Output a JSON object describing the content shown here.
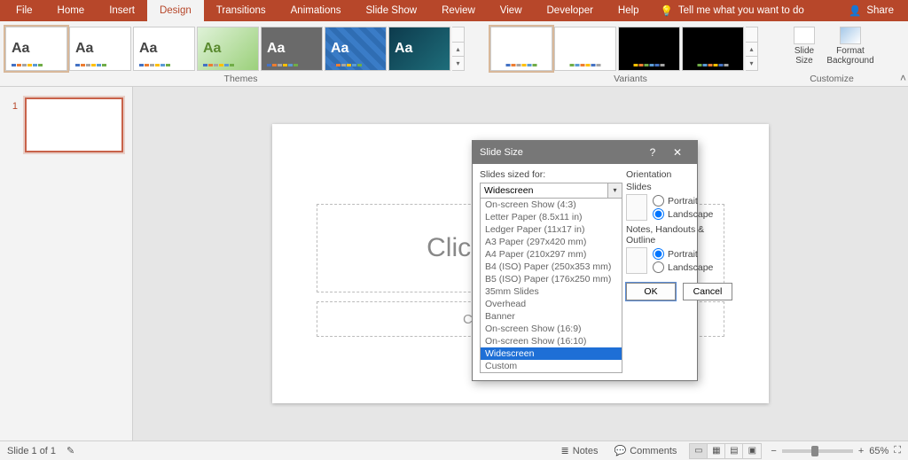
{
  "app": "PowerPoint",
  "accent": "#b7472a",
  "ribbon": {
    "tabs": [
      "File",
      "Home",
      "Insert",
      "Design",
      "Transitions",
      "Animations",
      "Slide Show",
      "Review",
      "View",
      "Developer",
      "Help"
    ],
    "active_tab_index": 3,
    "tell_me": "Tell me what you want to do",
    "share": "Share"
  },
  "groups": {
    "themes_label": "Themes",
    "variants_label": "Variants",
    "customize_label": "Customize",
    "slide_size_label": "Slide\nSize",
    "format_bg_label": "Format\nBackground"
  },
  "thumbnails": {
    "items": [
      {
        "number": "1"
      }
    ]
  },
  "slide_placeholders": {
    "title": "Click to add title",
    "subtitle": "Click to add subtitle"
  },
  "dialog": {
    "title": "Slide Size",
    "sized_for_label": "Slides sized for:",
    "sized_for_value": "Widescreen",
    "options": [
      "On-screen Show (4:3)",
      "Letter Paper (8.5x11 in)",
      "Ledger Paper (11x17 in)",
      "A3 Paper (297x420 mm)",
      "A4 Paper (210x297 mm)",
      "B4 (ISO) Paper (250x353 mm)",
      "B5 (ISO) Paper (176x250 mm)",
      "35mm Slides",
      "Overhead",
      "Banner",
      "On-screen Show (16:9)",
      "On-screen Show (16:10)",
      "Widescreen",
      "Custom"
    ],
    "selected_option_index": 12,
    "orientation_label": "Orientation",
    "slides_label": "Slides",
    "portrait_label": "Portrait",
    "landscape_label": "Landscape",
    "slides_orientation": "Landscape",
    "nho_label": "Notes, Handouts & Outline",
    "nho_orientation": "Portrait",
    "ok_label": "OK",
    "cancel_label": "Cancel"
  },
  "status": {
    "slide_info": "Slide 1 of 1",
    "notes": "Notes",
    "comments": "Comments",
    "zoom_pct": "65%",
    "zoom_slider_pos": 0.45
  }
}
